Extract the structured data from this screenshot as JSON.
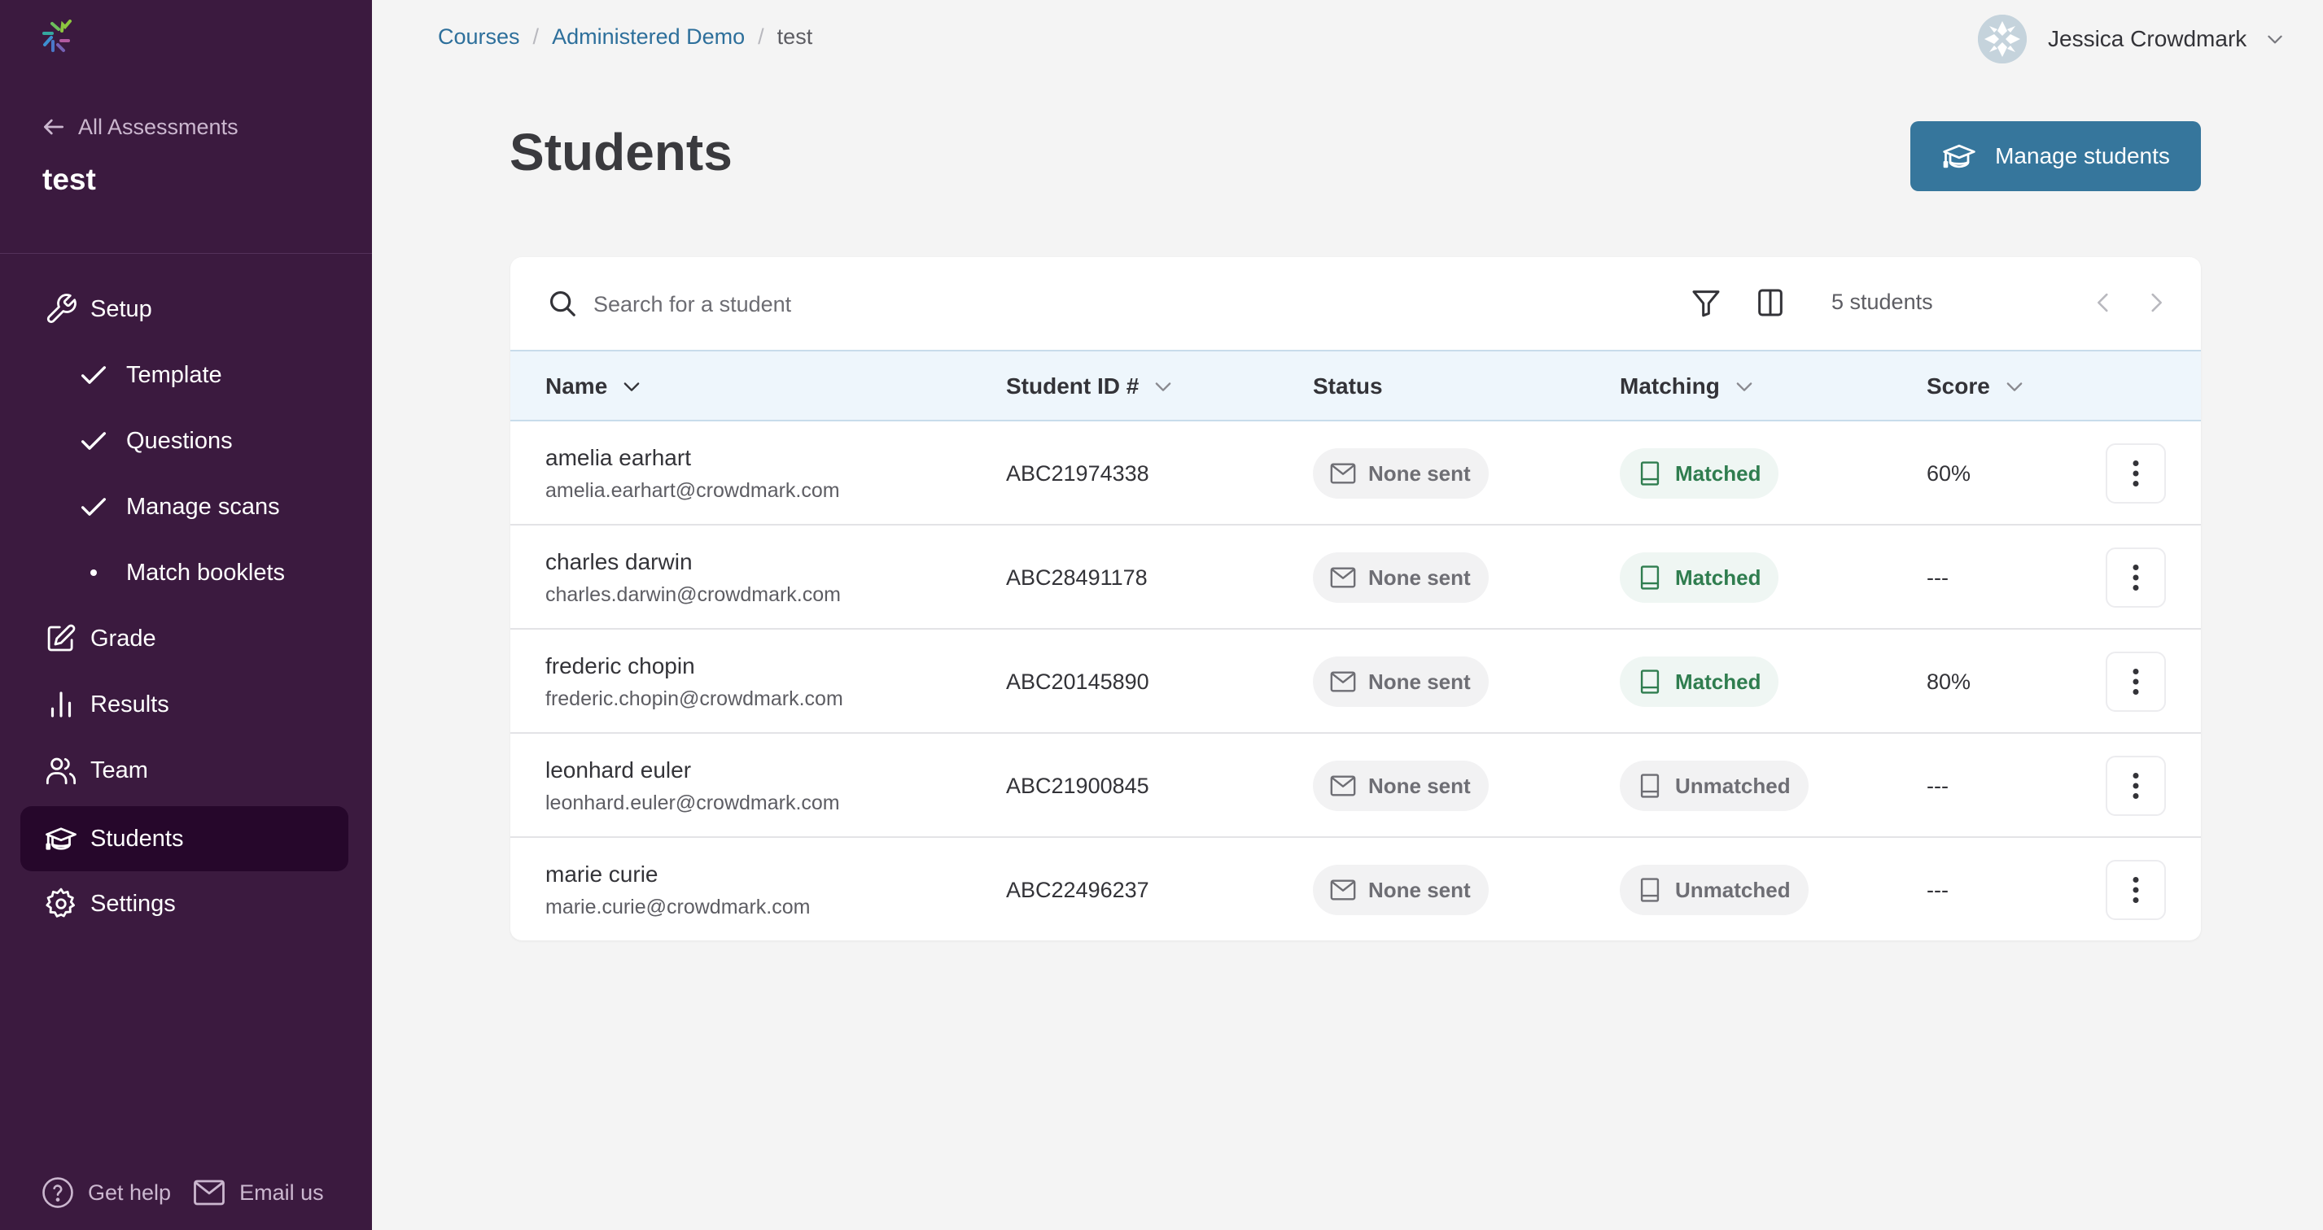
{
  "sidebar": {
    "back_label": "All Assessments",
    "assessment_title": "test",
    "nav": [
      {
        "label": "Setup",
        "icon": "wrench-icon",
        "sub": false,
        "active": false
      },
      {
        "label": "Template",
        "icon": "check-icon",
        "sub": true,
        "active": false
      },
      {
        "label": "Questions",
        "icon": "check-icon",
        "sub": true,
        "active": false
      },
      {
        "label": "Manage scans",
        "icon": "check-icon",
        "sub": true,
        "active": false
      },
      {
        "label": "Match booklets",
        "icon": "bullet-icon",
        "sub": true,
        "active": false
      },
      {
        "label": "Grade",
        "icon": "edit-icon",
        "sub": false,
        "active": false
      },
      {
        "label": "Results",
        "icon": "bar-chart-icon",
        "sub": false,
        "active": false
      },
      {
        "label": "Team",
        "icon": "users-icon",
        "sub": false,
        "active": false
      },
      {
        "label": "Students",
        "icon": "graduation-cap-icon",
        "sub": false,
        "active": true
      },
      {
        "label": "Settings",
        "icon": "gear-icon",
        "sub": false,
        "active": false
      }
    ],
    "footer": {
      "help_label": "Get help",
      "email_label": "Email us"
    }
  },
  "breadcrumb": {
    "items": [
      "Courses",
      "Administered Demo"
    ],
    "current": "test",
    "separator": "/"
  },
  "user": {
    "name": "Jessica Crowdmark"
  },
  "page": {
    "title": "Students",
    "manage_button": "Manage students"
  },
  "toolbar": {
    "search_placeholder": "Search for a student",
    "search_value": "",
    "count_label": "5 students"
  },
  "table": {
    "columns": [
      {
        "label": "Name",
        "sortable": true
      },
      {
        "label": "Student ID #",
        "sortable": true
      },
      {
        "label": "Status",
        "sortable": false
      },
      {
        "label": "Matching",
        "sortable": true
      },
      {
        "label": "Score",
        "sortable": true
      }
    ],
    "rows": [
      {
        "name": "amelia earhart",
        "email": "amelia.earhart@crowdmark.com",
        "student_id": "ABC21974338",
        "status": "None sent",
        "matching": "Matched",
        "score": "60%"
      },
      {
        "name": "charles darwin",
        "email": "charles.darwin@crowdmark.com",
        "student_id": "ABC28491178",
        "status": "None sent",
        "matching": "Matched",
        "score": "---"
      },
      {
        "name": "frederic chopin",
        "email": "frederic.chopin@crowdmark.com",
        "student_id": "ABC20145890",
        "status": "None sent",
        "matching": "Matched",
        "score": "80%"
      },
      {
        "name": "leonhard euler",
        "email": "leonhard.euler@crowdmark.com",
        "student_id": "ABC21900845",
        "status": "None sent",
        "matching": "Unmatched",
        "score": "---"
      },
      {
        "name": "marie curie",
        "email": "marie.curie@crowdmark.com",
        "student_id": "ABC22496237",
        "status": "None sent",
        "matching": "Unmatched",
        "score": "---"
      }
    ]
  },
  "colors": {
    "sidebar_bg": "#3b1a3f",
    "sidebar_active": "#26072b",
    "primary": "#36769c",
    "link": "#2d6f9b",
    "matched": "#2f7d4f",
    "header_row_bg": "#eef6fc"
  }
}
